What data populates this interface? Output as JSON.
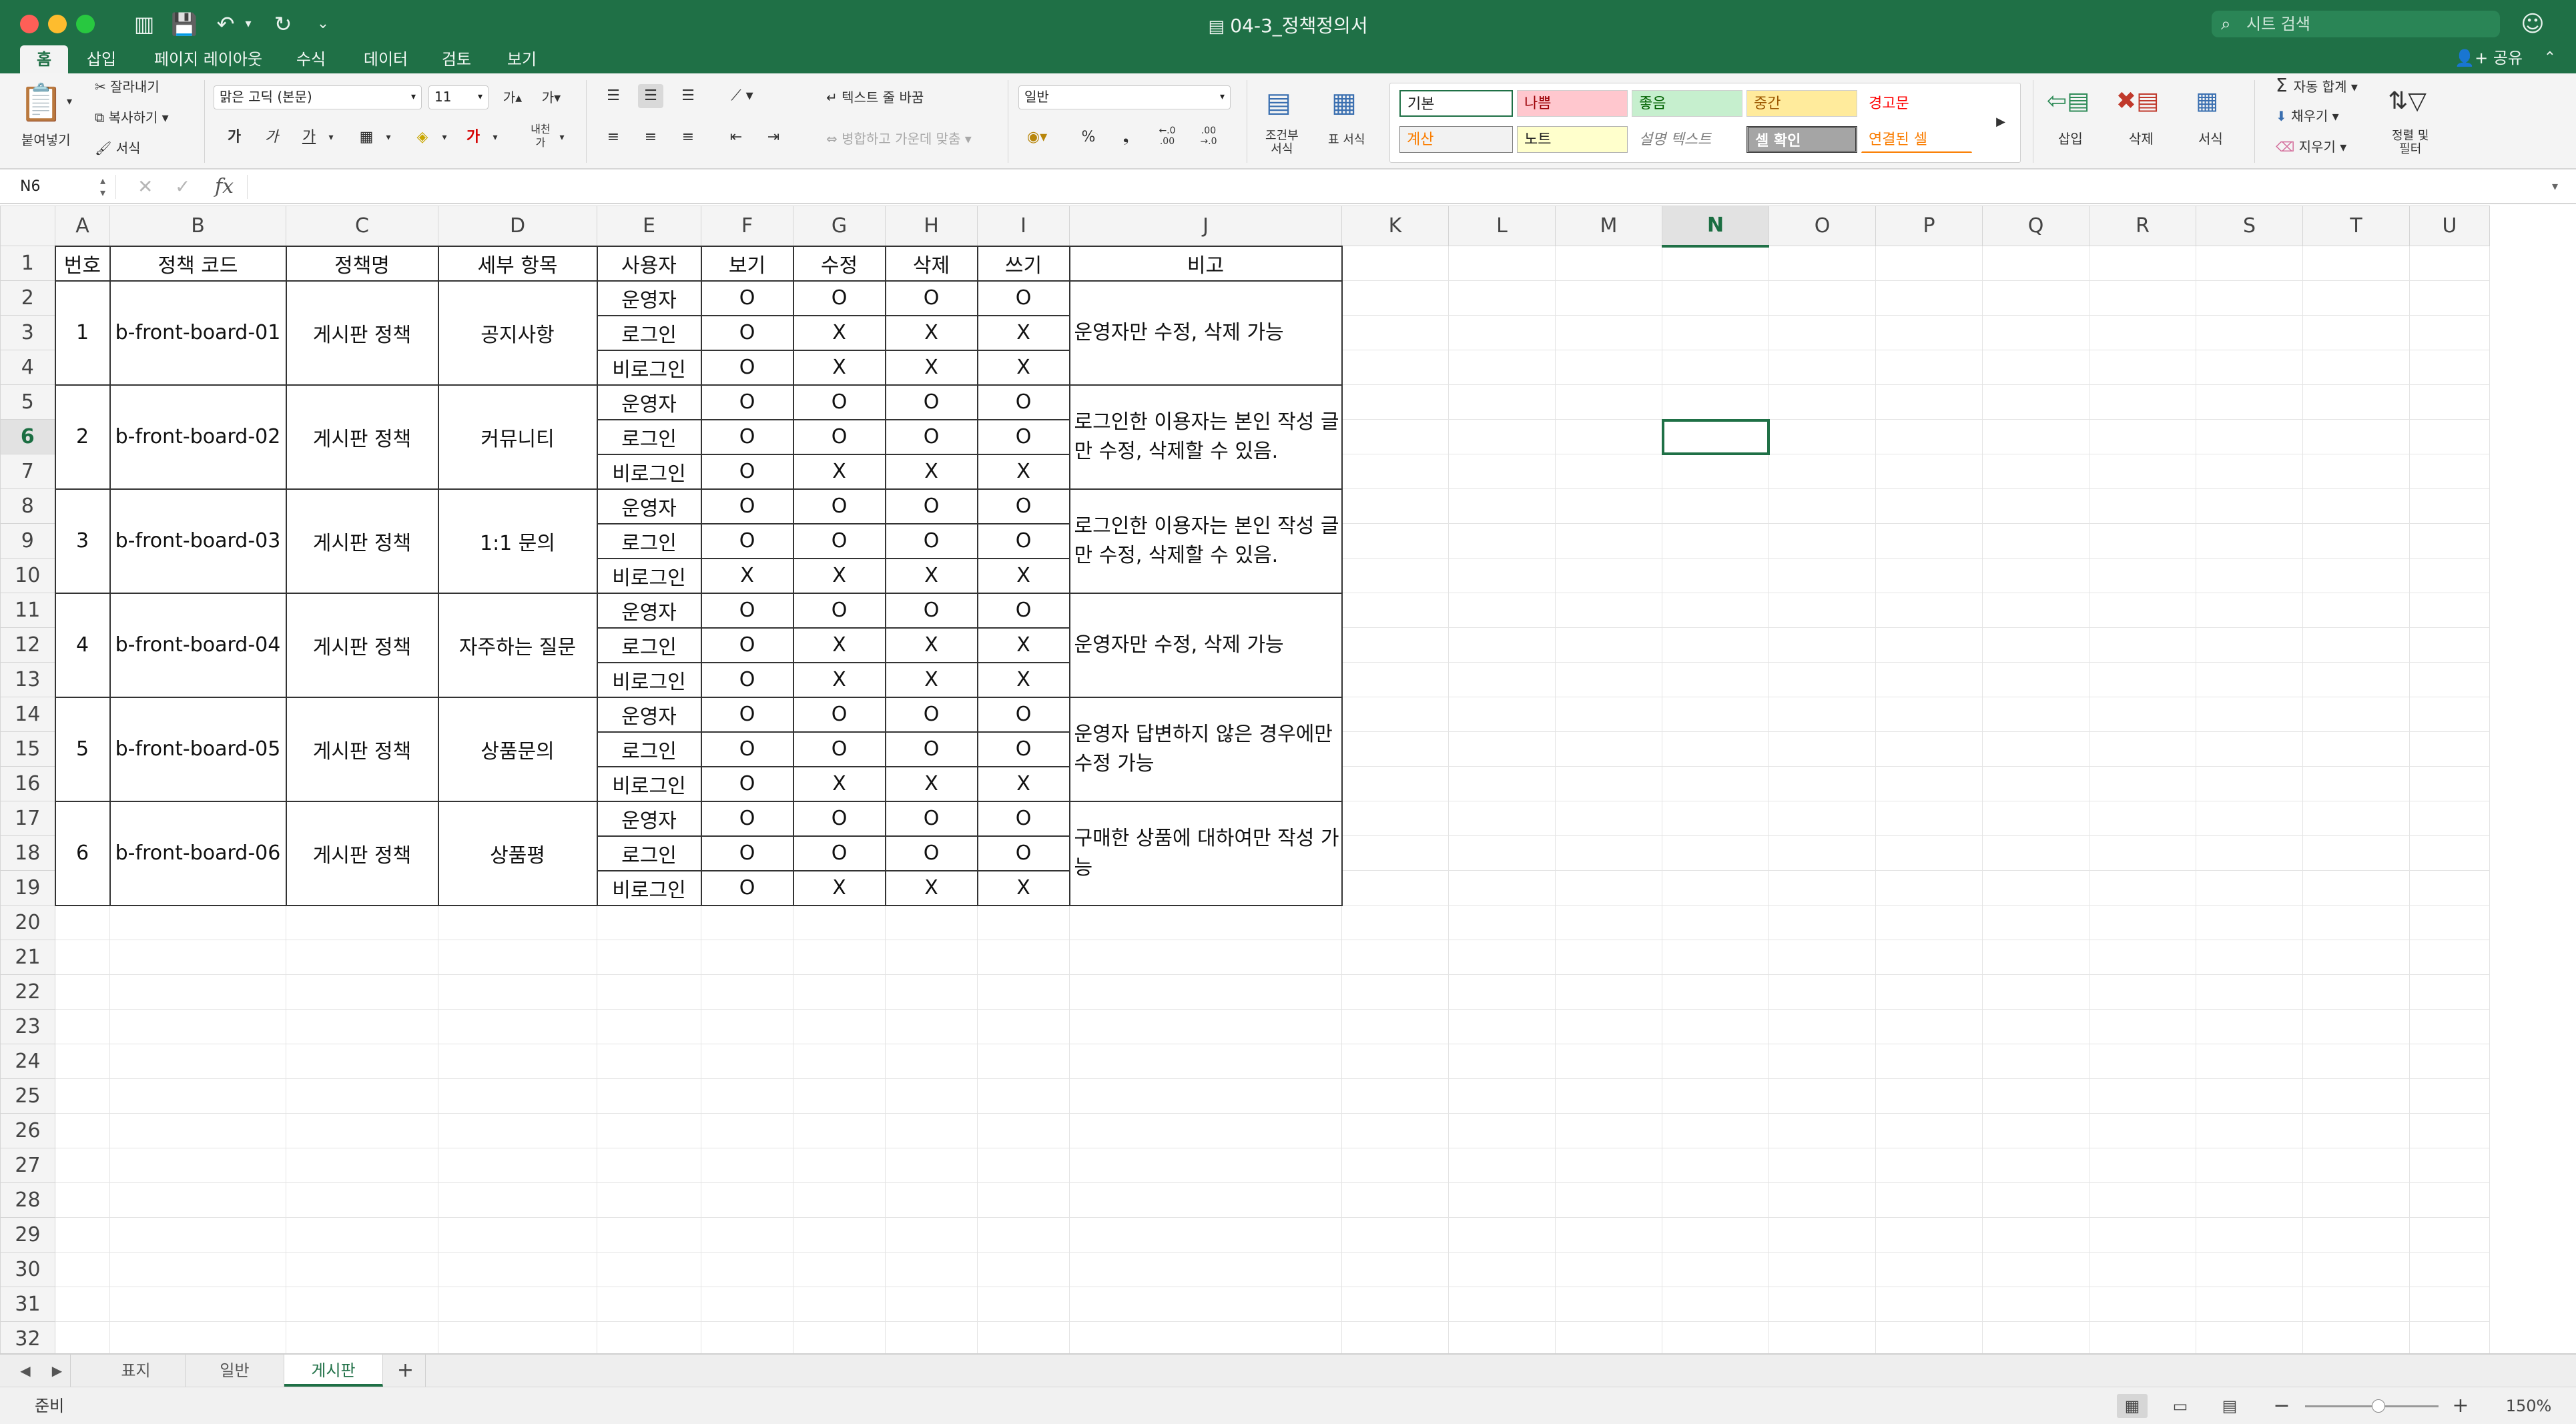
{
  "window": {
    "title": "04-3_정책정의서",
    "search_placeholder": "시트 검색",
    "share_label": "공유"
  },
  "tabs": [
    "홈",
    "삽입",
    "페이지 레이아웃",
    "수식",
    "데이터",
    "검토",
    "보기"
  ],
  "ribbon": {
    "paste": "붙여넣기",
    "cut": "잘라내기",
    "copy": "복사하기",
    "format_painter": "서식",
    "font_name": "맑은 고딕 (본문)",
    "font_size": "11",
    "wrap_text": "텍스트 줄 바꿈",
    "merge_center": "병합하고 가운데 맞춤",
    "number_format": "일반",
    "conditional_format": "조건부\n서식",
    "format_as_table": "표 서식",
    "cell_styles": [
      {
        "label": "기본",
        "bg": "#ffffff",
        "fg": "#222222"
      },
      {
        "label": "나쁨",
        "bg": "#ffc7ce",
        "fg": "#9c0006"
      },
      {
        "label": "좋음",
        "bg": "#c6efce",
        "fg": "#006100"
      },
      {
        "label": "중간",
        "bg": "#ffeb9c",
        "fg": "#9c5700"
      },
      {
        "label": "경고문",
        "bg": "#ffffff",
        "fg": "#ff0000"
      },
      {
        "label": "계산",
        "bg": "#f2f2f2",
        "fg": "#fa7d00"
      },
      {
        "label": "노트",
        "bg": "#ffffcc",
        "fg": "#222222"
      },
      {
        "label": "설명 텍스트",
        "bg": "#ffffff",
        "fg": "#7f7f7f"
      },
      {
        "label": "셀 확인",
        "bg": "#a5a5a5",
        "fg": "#ffffff"
      },
      {
        "label": "연결된 셀",
        "bg": "#ffffff",
        "fg": "#fa7d00"
      }
    ],
    "insert": "삽입",
    "delete": "삭제",
    "format": "서식",
    "autosum": "자동 합계",
    "fill": "채우기",
    "clear": "지우기",
    "sort_filter": "정렬 및\n필터"
  },
  "formula_bar": {
    "name_box": "N6",
    "fx": "fx",
    "formula": ""
  },
  "columns": [
    "A",
    "B",
    "C",
    "D",
    "E",
    "F",
    "G",
    "H",
    "I",
    "J",
    "K",
    "L",
    "M",
    "N",
    "O",
    "P",
    "Q",
    "R",
    "S",
    "T",
    "U"
  ],
  "active_column": "N",
  "active_row": 6,
  "selected_cell": "N6",
  "header_row": [
    "번호",
    "정책 코드",
    "정책명",
    "세부 항목",
    "사용자",
    "보기",
    "수정",
    "삭제",
    "쓰기",
    "비고"
  ],
  "policies": [
    {
      "no": "1",
      "code": "b-front-board-01",
      "name": "게시판 정책",
      "item": "공지사항",
      "note": "운영자만 수정, 삭제 가능",
      "perms": [
        [
          "운영자",
          "O",
          "O",
          "O",
          "O"
        ],
        [
          "로그인",
          "O",
          "X",
          "X",
          "X"
        ],
        [
          "비로그인",
          "O",
          "X",
          "X",
          "X"
        ]
      ]
    },
    {
      "no": "2",
      "code": "b-front-board-02",
      "name": "게시판 정책",
      "item": "커뮤니티",
      "note": "로그인한 이용자는 본인 작성 글만 수정, 삭제할 수 있음.",
      "perms": [
        [
          "운영자",
          "O",
          "O",
          "O",
          "O"
        ],
        [
          "로그인",
          "O",
          "O",
          "O",
          "O"
        ],
        [
          "비로그인",
          "O",
          "X",
          "X",
          "X"
        ]
      ]
    },
    {
      "no": "3",
      "code": "b-front-board-03",
      "name": "게시판 정책",
      "item": "1:1 문의",
      "note": "로그인한 이용자는 본인 작성 글만 수정, 삭제할 수 있음.",
      "perms": [
        [
          "운영자",
          "O",
          "O",
          "O",
          "O"
        ],
        [
          "로그인",
          "O",
          "O",
          "O",
          "O"
        ],
        [
          "비로그인",
          "X",
          "X",
          "X",
          "X"
        ]
      ]
    },
    {
      "no": "4",
      "code": "b-front-board-04",
      "name": "게시판 정책",
      "item": "자주하는 질문",
      "note": "운영자만 수정, 삭제 가능",
      "perms": [
        [
          "운영자",
          "O",
          "O",
          "O",
          "O"
        ],
        [
          "로그인",
          "O",
          "X",
          "X",
          "X"
        ],
        [
          "비로그인",
          "O",
          "X",
          "X",
          "X"
        ]
      ]
    },
    {
      "no": "5",
      "code": "b-front-board-05",
      "name": "게시판 정책",
      "item": "상품문의",
      "note": "운영자 답변하지 않은 경우에만 수정 가능",
      "perms": [
        [
          "운영자",
          "O",
          "O",
          "O",
          "O"
        ],
        [
          "로그인",
          "O",
          "O",
          "O",
          "O"
        ],
        [
          "비로그인",
          "O",
          "X",
          "X",
          "X"
        ]
      ]
    },
    {
      "no": "6",
      "code": "b-front-board-06",
      "name": "게시판 정책",
      "item": "상품평",
      "note": "구매한 상품에 대하여만 작성 가능",
      "perms": [
        [
          "운영자",
          "O",
          "O",
          "O",
          "O"
        ],
        [
          "로그인",
          "O",
          "O",
          "O",
          "O"
        ],
        [
          "비로그인",
          "O",
          "X",
          "X",
          "X"
        ]
      ]
    }
  ],
  "visible_rows": [
    "1",
    "2",
    "3",
    "4",
    "5",
    "6",
    "7",
    "8",
    "9",
    "10",
    "11",
    "12",
    "13",
    "14",
    "15",
    "16",
    "17",
    "18",
    "19",
    "20",
    "21",
    "22",
    "23",
    "24",
    "25",
    "26",
    "27",
    "28",
    "29",
    "30",
    "31",
    "32"
  ],
  "sheets": [
    "표지",
    "일반",
    "게시판"
  ],
  "active_sheet": "게시판",
  "status": {
    "ready": "준비",
    "zoom": "150%"
  },
  "colors": {
    "accent": "#1f7046",
    "grid_line": "#e4e4e4",
    "table_border": "#333333"
  }
}
